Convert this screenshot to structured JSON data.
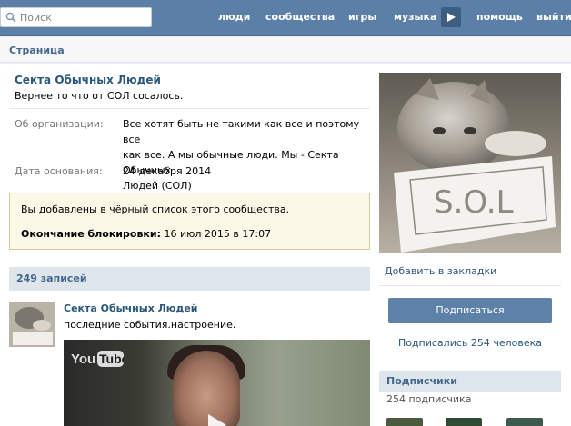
{
  "search": {
    "placeholder": "Поиск"
  },
  "nav": {
    "items": [
      "люди",
      "сообщества",
      "игры",
      "музыка",
      "помощь",
      "выйти"
    ]
  },
  "page": {
    "title": "Страница"
  },
  "group": {
    "name": "Секта Обычных Людей",
    "status": "Вернее то что от СОЛ сосалось.",
    "about_label": "Об организации:",
    "about_lines": [
      "Все хотят быть не такими как все и поэтому все",
      "как все. А мы обычные люди. Мы - Секта Обычных",
      "Людей (СОЛ)"
    ],
    "founded_label": "Дата основания:",
    "founded_value": "24 декабря 2014"
  },
  "blacklist": {
    "message": "Вы добавлены в чёрный список этого сообщества.",
    "end_label": "Окончание блокировки:",
    "end_value": "16 июл 2015 в 17:07"
  },
  "posts": {
    "count_label": "249 записей",
    "author": "Секта Обычных Людей",
    "text": "последние события.настроение."
  },
  "sidebar": {
    "bookmark_label": "Добавить в закладки",
    "subscribe_label": "Подписаться",
    "subscribed_count": "Подписались 254 человека",
    "subscribers_title": "Подписчики",
    "subscribers_count": "254 подписчика"
  },
  "colors": {
    "header_blue": "#5b7fa6",
    "link_blue": "#2b587a",
    "button_blue": "#5e81a8",
    "notice_bg": "#fbf8e7"
  },
  "icons": {
    "search": "search-icon",
    "nav_more": "play-arrow-icon",
    "video_play": "play-icon"
  }
}
